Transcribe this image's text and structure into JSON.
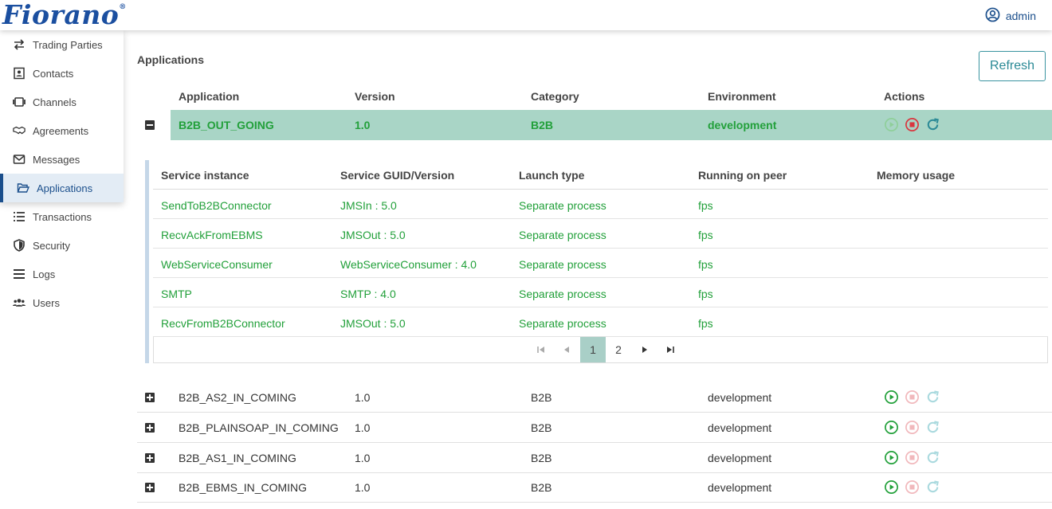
{
  "brand": {
    "logo_text": "Fiorano",
    "logo_mark": "®"
  },
  "user": {
    "name": "admin",
    "icon": "user-circle-icon"
  },
  "sidebar": {
    "items": [
      {
        "label": "Trading Parties",
        "icon": "exchange-icon"
      },
      {
        "label": "Contacts",
        "icon": "contact-card-icon"
      },
      {
        "label": "Channels",
        "icon": "channel-icon"
      },
      {
        "label": "Agreements",
        "icon": "handshake-icon"
      },
      {
        "label": "Messages",
        "icon": "envelope-icon"
      },
      {
        "label": "Applications",
        "icon": "folder-open-icon",
        "active": true
      },
      {
        "label": "Transactions",
        "icon": "list-icon"
      },
      {
        "label": "Security",
        "icon": "shield-icon"
      },
      {
        "label": "Logs",
        "icon": "bars-icon"
      },
      {
        "label": "Users",
        "icon": "users-icon"
      }
    ]
  },
  "main": {
    "title": "Applications",
    "refresh_label": "Refresh",
    "columns": [
      "Application",
      "Version",
      "Category",
      "Environment",
      "Actions"
    ],
    "expanded_app": {
      "name": "B2B_OUT_GOING",
      "version": "1.0",
      "category": "B2B",
      "environment": "development"
    },
    "service_columns": [
      "Service instance",
      "Service GUID/Version",
      "Launch type",
      "Running on peer",
      "Memory usage"
    ],
    "services": [
      {
        "instance": "SendToB2BConnector",
        "guid": "JMSIn : 5.0",
        "launch": "Separate process",
        "peer": "fps",
        "memory": ""
      },
      {
        "instance": "RecvAckFromEBMS",
        "guid": "JMSOut : 5.0",
        "launch": "Separate process",
        "peer": "fps",
        "memory": ""
      },
      {
        "instance": "WebServiceConsumer",
        "guid": "WebServiceConsumer : 4.0",
        "launch": "Separate process",
        "peer": "fps",
        "memory": ""
      },
      {
        "instance": "SMTP",
        "guid": "SMTP : 4.0",
        "launch": "Separate process",
        "peer": "fps",
        "memory": ""
      },
      {
        "instance": "RecvFromB2BConnector",
        "guid": "JMSOut : 5.0",
        "launch": "Separate process",
        "peer": "fps",
        "memory": ""
      }
    ],
    "pager": {
      "pages": [
        "1",
        "2"
      ],
      "current": "1"
    },
    "apps": [
      {
        "name": "B2B_AS2_IN_COMING",
        "version": "1.0",
        "category": "B2B",
        "environment": "development"
      },
      {
        "name": "B2B_PLAINSOAP_IN_COMING",
        "version": "1.0",
        "category": "B2B",
        "environment": "development"
      },
      {
        "name": "B2B_AS1_IN_COMING",
        "version": "1.0",
        "category": "B2B",
        "environment": "development"
      },
      {
        "name": "B2B_EBMS_IN_COMING",
        "version": "1.0",
        "category": "B2B",
        "environment": "development"
      }
    ]
  },
  "colors": {
    "brand": "#1b4fa0",
    "running_green": "#22a03a",
    "expanded_row": "#a9d5c6",
    "stop_red": "#d9363e",
    "restart_teal": "#2b8a96"
  }
}
